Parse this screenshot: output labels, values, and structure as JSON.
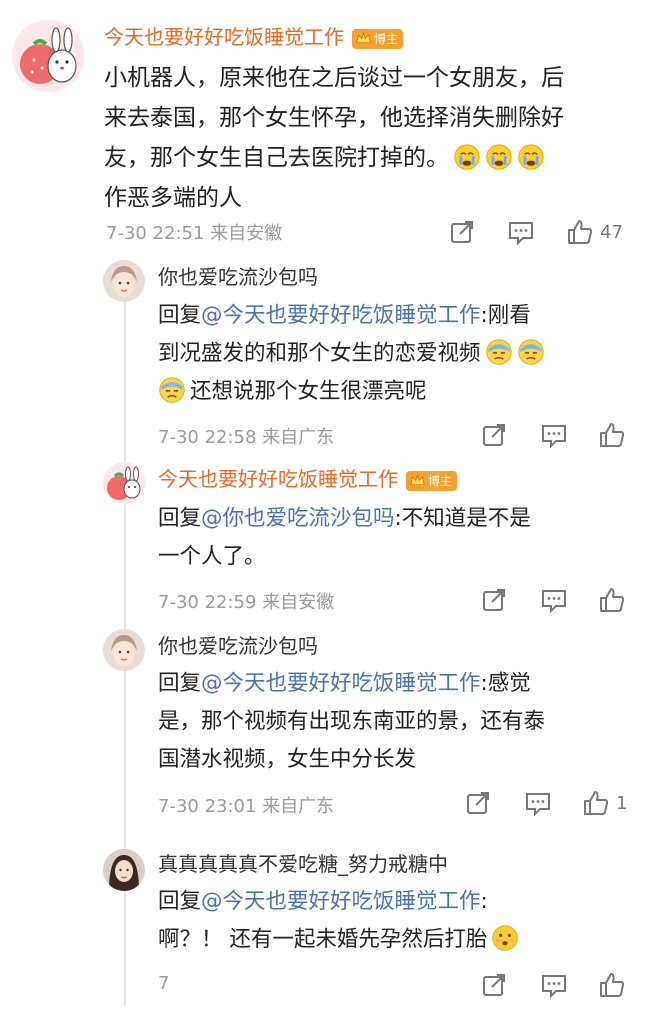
{
  "main_comment": {
    "username": "今天也要好好吃饭睡觉工作",
    "badge": "博主",
    "text_lines": [
      "小机器人，原来他在之后谈过一个女朋友，后",
      "来去泰国，那个女生怀孕，他选择消失删除好",
      "友，那个女生自己去医院打掉的。",
      "作恶多端的人"
    ],
    "emoji": "crying-face",
    "date": "7-30 22:51",
    "location": "来自安徽",
    "like_count": "47"
  },
  "replies": [
    {
      "username": "你也爱吃流沙包吗",
      "reply_prefix": "回复",
      "mention": "@今天也要好好吃饭睡觉工作",
      "text_lines": [
        ":刚看",
        "到况盛发的和那个女生的恋爱视频",
        "还想说那个女生很漂亮呢"
      ],
      "emoji": "sweat-face",
      "date": "7-30 22:58",
      "location": "来自广东",
      "like_count": ""
    },
    {
      "username": "今天也要好好吃饭睡觉工作",
      "badge": "博主",
      "reply_prefix": "回复",
      "mention": "@你也爱吃流沙包吗",
      "text_lines": [
        ":不知道是不是",
        "一个人了。"
      ],
      "date": "7-30 22:59",
      "location": "来自安徽",
      "like_count": ""
    },
    {
      "username": "你也爱吃流沙包吗",
      "reply_prefix": "回复",
      "mention": "@今天也要好好吃饭睡觉工作",
      "text_lines": [
        ":感觉",
        "是，那个视频有出现东南亚的景，还有泰",
        "国潜水视频，女生中分长发"
      ],
      "date": "7-30 23:01",
      "location": "来自广东",
      "like_count": "1"
    },
    {
      "username": "真真真真真不爱吃糖_努力戒糖中",
      "reply_prefix": "回复",
      "mention": "@今天也要好好吃饭睡觉工作",
      "text_lines": [
        ":",
        "啊？！ 还有一起未婚先孕然后打胎"
      ],
      "emoji": "frown-face",
      "date": "7",
      "location": "",
      "like_count": ""
    }
  ],
  "colors": {
    "username_orange": "#e86a24",
    "mention_blue": "#4a72b2",
    "meta_gray": "#9a9a9a",
    "badge_orange": "#f6a02f"
  }
}
